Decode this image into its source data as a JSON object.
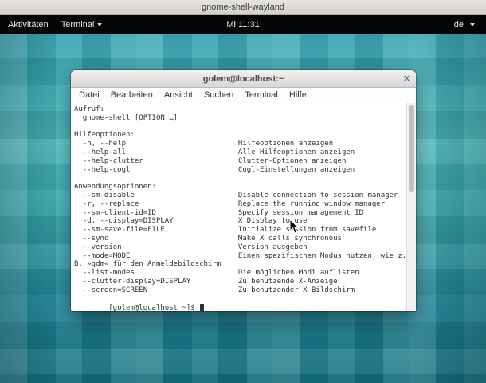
{
  "outer_window": {
    "title": "gnome-shell-wayland"
  },
  "top_bar": {
    "activities": "Aktivitäten",
    "app_menu": "Terminal",
    "clock": "Mi 11:31",
    "keyboard_layout": "de"
  },
  "terminal": {
    "title": "golem@localhost:~",
    "close_label": "✕",
    "menus": [
      "Datei",
      "Bearbeiten",
      "Ansicht",
      "Suchen",
      "Terminal",
      "Hilfe"
    ],
    "usage_label": "Aufruf:",
    "usage": "gnome-shell [OPTION …]",
    "sections": [
      {
        "title": "Hilfeoptionen:",
        "entries": [
          {
            "opt": "-h, --help",
            "desc": "Hilfeoptionen anzeigen"
          },
          {
            "opt": "--help-all",
            "desc": "Alle Hilfeoptionen anzeigen"
          },
          {
            "opt": "--help-clutter",
            "desc": "Clutter-Optionen anzeigen"
          },
          {
            "opt": "--help-cogl",
            "desc": "Cogl-Einstellungen anzeigen"
          }
        ]
      },
      {
        "title": "Anwendungsoptionen:",
        "entries": [
          {
            "opt": "--sm-disable",
            "desc": "Disable connection to session manager"
          },
          {
            "opt": "-r, --replace",
            "desc": "Replace the running window manager"
          },
          {
            "opt": "--sm-client-id=ID",
            "desc": "Specify session management ID"
          },
          {
            "opt": "-d, --display=DISPLAY",
            "desc": "X Display to use"
          },
          {
            "opt": "--sm-save-file=FILE",
            "desc": "Initialize session from savefile"
          },
          {
            "opt": "--sync",
            "desc": "Make X calls synchronous"
          },
          {
            "opt": "--version",
            "desc": "Version ausgeben"
          },
          {
            "opt": "--mode=MODE",
            "desc": "Einen spezifischen Modus nutzen, wie z."
          },
          {
            "raw": "B. »gdm« für den Anmeldebildschirm"
          },
          {
            "opt": "--list-modes",
            "desc": "Die möglichen Modi auflisten"
          },
          {
            "opt": "--clutter-display=DISPLAY",
            "desc": "Zu benutzende X-Anzeige"
          },
          {
            "opt": "--screen=SCREEN",
            "desc": "Zu benutzender X-Bildschirm"
          }
        ]
      }
    ],
    "prompt": "[golem@localhost ~]$"
  },
  "colors": {
    "top_bar_bg": "#050505",
    "terminal_text": "#2e3436",
    "desktop_teal": "#35a3b0",
    "titlebar_gray": "#d9d7d5"
  }
}
